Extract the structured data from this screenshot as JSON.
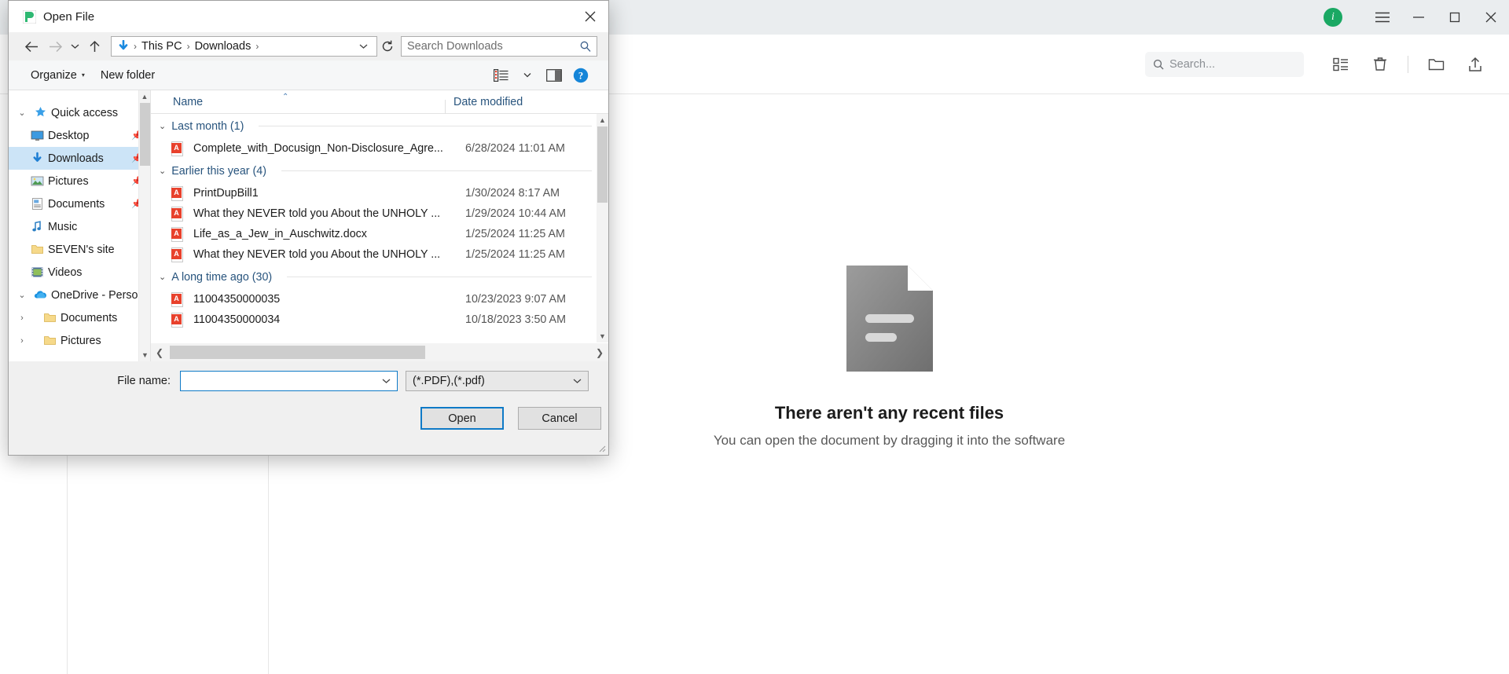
{
  "app": {
    "titlebar": {
      "info_badge": "i",
      "menu_icon": "hamburger-icon",
      "minimize": "minimize-icon",
      "maximize": "maximize-icon",
      "close": "close-icon"
    },
    "toolbar": {
      "search_placeholder": "Search...",
      "icons": [
        "grid-view-icon",
        "trash-icon",
        "new-folder-icon",
        "share-upload-icon"
      ]
    },
    "empty_state": {
      "title": "There aren't any recent files",
      "subtitle": "You can open the document by dragging it into the software",
      "icon": "document-placeholder-icon"
    }
  },
  "dialog": {
    "title": "Open File",
    "title_icon": "app-logo-icon",
    "close_label": "✕",
    "nav": {
      "back": "back-arrow-icon",
      "forward": "forward-arrow-icon",
      "recent": "chevron-down-icon",
      "up": "up-arrow-icon",
      "breadcrumb_icon": "downloads-arrow-icon",
      "crumbs": [
        "This PC",
        "Downloads"
      ],
      "separator": "›",
      "dropdown": "chevron-down-icon",
      "refresh": "refresh-icon",
      "search_placeholder": "Search Downloads",
      "search_icon": "search-icon"
    },
    "commandbar": {
      "organize": "Organize",
      "organize_caret": "▾",
      "new_folder": "New folder",
      "view_icon": "view-list-icon",
      "view_caret": "▾",
      "preview_icon": "preview-pane-icon",
      "help_icon": "help-icon"
    },
    "nav_pane": {
      "groups": [
        {
          "label": "Quick access",
          "icon": "star-pin-icon",
          "twisty": "⌄",
          "expanded": true,
          "items": [
            {
              "label": "Desktop",
              "icon": "desktop-icon",
              "pinned": true,
              "selected": false
            },
            {
              "label": "Downloads",
              "icon": "download-arrow-icon",
              "pinned": true,
              "selected": true
            },
            {
              "label": "Pictures",
              "icon": "pictures-icon",
              "pinned": true,
              "selected": false
            },
            {
              "label": "Documents",
              "icon": "documents-icon",
              "pinned": true,
              "selected": false
            },
            {
              "label": "Music",
              "icon": "music-note-icon",
              "pinned": false,
              "selected": false
            },
            {
              "label": "SEVEN's site",
              "icon": "folder-icon",
              "pinned": false,
              "selected": false
            },
            {
              "label": "Videos",
              "icon": "videos-icon",
              "pinned": false,
              "selected": false
            }
          ]
        },
        {
          "label": "OneDrive - Person",
          "icon": "onedrive-cloud-icon",
          "twisty": "⌄",
          "expanded": true,
          "items": [
            {
              "label": "Documents",
              "icon": "folder-icon",
              "twisty": "›",
              "pinned": false,
              "selected": false
            },
            {
              "label": "Pictures",
              "icon": "folder-icon",
              "twisty": "›",
              "pinned": false,
              "selected": false
            }
          ]
        }
      ]
    },
    "file_list": {
      "columns": {
        "name": "Name",
        "date_modified": "Date modified"
      },
      "sort_indicator": "⌃",
      "groups": [
        {
          "label": "Last month (1)",
          "twisty": "⌄",
          "files": [
            {
              "name": "Complete_with_Docusign_Non-Disclosure_Agre...",
              "date": "6/28/2024 11:01 AM",
              "icon": "pdf-file-icon"
            }
          ]
        },
        {
          "label": "Earlier this year (4)",
          "twisty": "⌄",
          "files": [
            {
              "name": "PrintDupBill1",
              "date": "1/30/2024 8:17 AM",
              "icon": "pdf-file-icon"
            },
            {
              "name": "What they NEVER told you About the UNHOLY ...",
              "date": "1/29/2024 10:44 AM",
              "icon": "pdf-file-icon"
            },
            {
              "name": "Life_as_a_Jew_in_Auschwitz.docx",
              "date": "1/25/2024 11:25 AM",
              "icon": "pdf-file-icon"
            },
            {
              "name": "What they NEVER told you About the UNHOLY ...",
              "date": "1/25/2024 11:25 AM",
              "icon": "pdf-file-icon"
            }
          ]
        },
        {
          "label": "A long time ago (30)",
          "twisty": "⌄",
          "files": [
            {
              "name": "11004350000035",
              "date": "10/23/2023 9:07 AM",
              "icon": "pdf-file-icon"
            },
            {
              "name": "11004350000034",
              "date": "10/18/2023 3:50 AM",
              "icon": "pdf-file-icon"
            }
          ]
        }
      ]
    },
    "footer": {
      "file_name_label": "File name:",
      "file_name_value": "",
      "file_name_caret": "⌄",
      "filter_value": "(*.PDF),(*.pdf)",
      "filter_caret": "⌄",
      "open_button": "Open",
      "cancel_button": "Cancel"
    }
  },
  "colors": {
    "accent_blue": "#0f7ac7",
    "group_header_blue": "#28547d",
    "selection_blue": "#cce4f7",
    "pdf_red": "#e8412c",
    "badge_green": "#1aa863"
  }
}
